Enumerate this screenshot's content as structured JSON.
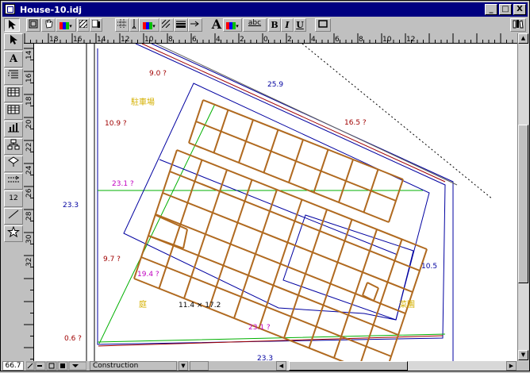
{
  "window": {
    "title": "House-10.idj"
  },
  "window_buttons": {
    "minimize": "_",
    "maximize": "□",
    "close": "X"
  },
  "toolbar": {
    "text_tool": "A",
    "font_sample": "abc",
    "bold": "B",
    "italic": "I",
    "underline": "U"
  },
  "left_tools": {
    "text": "A",
    "grid_value": "12"
  },
  "ruler_h": {
    "ticks": [
      "18",
      "16",
      "14",
      "12",
      "10",
      "8",
      "6",
      "4",
      "2",
      "0",
      "2",
      "4",
      "6",
      "8",
      "10",
      "12"
    ]
  },
  "ruler_v": {
    "ticks": [
      "14",
      "16",
      "18",
      "20",
      "22",
      "24",
      "26",
      "28",
      "30",
      "32"
    ]
  },
  "drawing": {
    "labels": {
      "a": "9.0 ?",
      "b": "25.9",
      "c": "駐車場",
      "d": "10.9 ?",
      "e": "16.5 ?",
      "f": "23.1 ?",
      "g": "23.3",
      "h": "9.7 ?",
      "i": "19.4 ?",
      "j": "10.5",
      "k": "庭",
      "l": "11.4 × 17.2",
      "m": "菜園",
      "n": "0.6 ?",
      "o": "23.1 ?",
      "p": "23.3"
    },
    "colors": {
      "blue": "#0000a0",
      "green": "#00b000",
      "brown": "#8b4513",
      "darkred": "#a00000",
      "magenta": "#c000c0",
      "yellow": "#d4b000",
      "frame": "#b06a20"
    }
  },
  "status": {
    "zoom": "66.7",
    "layer": "Construction"
  }
}
